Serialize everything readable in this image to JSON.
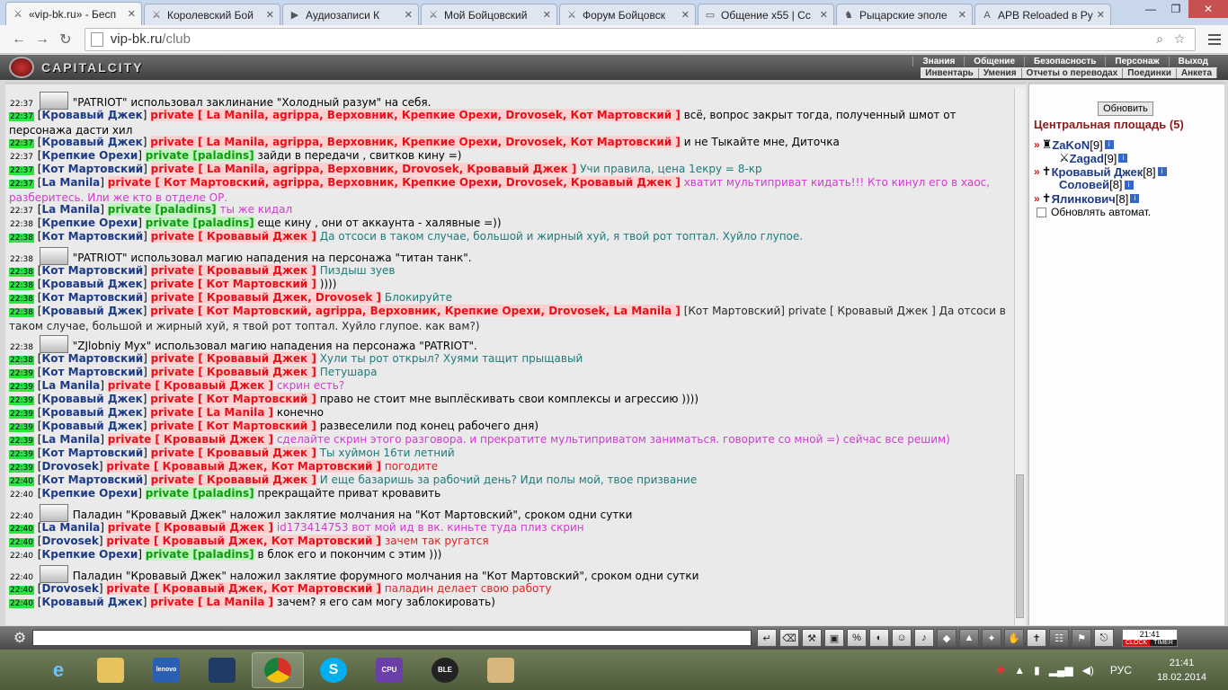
{
  "browser": {
    "tabs": [
      {
        "label": "«vip-bk.ru» - Бесп",
        "icon": "swords-icon",
        "active": true
      },
      {
        "label": "Королевский Бой",
        "icon": "swords-icon"
      },
      {
        "label": "Аудиозаписи К",
        "icon": "audio-icon"
      },
      {
        "label": "Мой Бойцовский",
        "icon": "swords-icon"
      },
      {
        "label": "Форум Бойцовск",
        "icon": "swords-icon"
      },
      {
        "label": "Общение х55 | Сс",
        "icon": "page-icon"
      },
      {
        "label": "Рыцарские эполе",
        "icon": "knight-icon"
      },
      {
        "label": "APB Reloaded в Ру",
        "icon": "apb-icon"
      }
    ],
    "url_host": "vip-bk.ru",
    "url_path": "/club"
  },
  "site": {
    "logo_text": "CAPITALCITY",
    "top_nav": [
      "Знания",
      "Общение",
      "Безопасность",
      "Персонаж",
      "Выход"
    ],
    "sub_nav": [
      "Инвентарь",
      "Умения",
      "Отчеты о переводах",
      "Поединки",
      "Анкета"
    ]
  },
  "chat": {
    "messages": [
      {
        "time": "22:37",
        "hl": false,
        "sys": true,
        "text": "\"PATRIOT\" использовал заклинание \"Холодный разум\" на себя."
      },
      {
        "time": "22:37",
        "hl": true,
        "nick": "Кровавый Джек",
        "priv": "private [ La Manila, agrippa, Верховник, Крепкие Орехи, Drovosek, Кот Мартовский ]",
        "privType": "pm",
        "text": "всё, вопрос закрыт тогда, полученный шмот от персонажа дасти хил",
        "tc": "t-black",
        "lines": 2
      },
      {
        "time": "22:37",
        "hl": true,
        "nick": "Кровавый Джек",
        "priv": "private [ La Manila, agrippa, Верховник, Крепкие Орехи, Drovosek, Кот Мартовский ]",
        "privType": "pm",
        "text": "и не Тыкайте мне, Диточка",
        "tc": "t-black"
      },
      {
        "time": "22:37",
        "hl": false,
        "nick": "Крепкие Орехи",
        "priv": "private [paladins]",
        "privType": "pal",
        "text": "зайди в передачи , свитков кину =)",
        "tc": "t-black"
      },
      {
        "time": "22:37",
        "hl": true,
        "nick": "Кот Мартовский",
        "priv": "private [ La Manila, agrippa, Верховник, Drovosek, Кровавый Джек ]",
        "privType": "pm",
        "text": "Учи правила, цена 1екру = 8-кр",
        "tc": "t-teal"
      },
      {
        "time": "22:37",
        "hl": true,
        "nick": "La Manila",
        "priv": "private [ Кот Мартовский, agrippa, Верховник, Крепкие Орехи, Drovosek, Кровавый Джек ]",
        "privType": "pm",
        "text": "хватит мультиприват кидать!!! Кто кинул его в хаос, разберитесь. Или же кто в отделе ОР.",
        "tc": "t-mag",
        "lines": 2
      },
      {
        "time": "22:37",
        "hl": false,
        "nick": "La Manila",
        "priv": "private [paladins]",
        "privType": "pal",
        "text": "ты же кидал",
        "tc": "t-mag"
      },
      {
        "time": "22:38",
        "hl": false,
        "nick": "Крепкие Орехи",
        "priv": "private [paladins]",
        "privType": "pal",
        "text": "еще кину , они от аккаунта - халявные =))",
        "tc": "t-black"
      },
      {
        "time": "22:38",
        "hl": true,
        "nick": "Кот Мартовский",
        "priv": "private [ Кровавый Джек ]",
        "privType": "pm",
        "text": "Да отсоси в таком случае, большой и жирный хуй, я твой рот топтал. Хуйло глупое.",
        "tc": "t-teal"
      },
      {
        "time": "22:38",
        "hl": false,
        "sys": true,
        "text": "\"PATRIOT\" использовал магию нападения на персонажа \"титан танк\"."
      },
      {
        "time": "22:38",
        "hl": true,
        "nick": "Кот Мартовский",
        "priv": "private [ Кровавый Джек ]",
        "privType": "pm",
        "text": "Пиздыш зуев",
        "tc": "t-teal"
      },
      {
        "time": "22:38",
        "hl": true,
        "nick": "Кровавый Джек",
        "priv": "private [ Кот Мартовский ]",
        "privType": "pm",
        "text": "))))",
        "tc": "t-black"
      },
      {
        "time": "22:38",
        "hl": true,
        "nick": "Кот Мартовский",
        "priv": "private [ Кровавый Джек, Drovosek ]",
        "privType": "pm",
        "text": "Блокируйте",
        "tc": "t-teal"
      },
      {
        "time": "22:38",
        "hl": true,
        "nick": "Кровавый Джек",
        "priv": "private [ Кот Мартовский, agrippa, Верховник, Крепкие Орехи, Drovosek, La Manila ]",
        "privType": "pm",
        "text": "[Кот Мартовский] private [ Кровавый Джек ] Да отсоси в таком случае, большой и жирный хуй, я твой рот топтал. Хуйло глупое. как вам?)",
        "tc": "t-dark",
        "lines": 2
      },
      {
        "time": "22:38",
        "hl": false,
        "sys": true,
        "text": "\"ZJlobniy Myx\" использовал магию нападения на персонажа \"PATRIOT\"."
      },
      {
        "time": "22:38",
        "hl": true,
        "nick": "Кот Мартовский",
        "priv": "private [ Кровавый Джек ]",
        "privType": "pm",
        "text": "Хули ты рот открыл? Хуями тащит прыщавый",
        "tc": "t-teal"
      },
      {
        "time": "22:39",
        "hl": true,
        "nick": "Кот Мартовский",
        "priv": "private [ Кровавый Джек ]",
        "privType": "pm",
        "text": "Петушара",
        "tc": "t-teal"
      },
      {
        "time": "22:39",
        "hl": true,
        "nick": "La Manila",
        "priv": "private [ Кровавый Джек ]",
        "privType": "pm",
        "text": "скрин есть?",
        "tc": "t-mag"
      },
      {
        "time": "22:39",
        "hl": true,
        "nick": "Кровавый Джек",
        "priv": "private [ Кот Мартовский ]",
        "privType": "pm",
        "text": "право не стоит мне выплёскивать свои комплексы и агрессию ))))",
        "tc": "t-black"
      },
      {
        "time": "22:39",
        "hl": true,
        "nick": "Кровавый Джек",
        "priv": "private [ La Manila ]",
        "privType": "pm",
        "text": "конечно",
        "tc": "t-black"
      },
      {
        "time": "22:39",
        "hl": true,
        "nick": "Кровавый Джек",
        "priv": "private [ Кот Мартовский ]",
        "privType": "pm",
        "text": "развеселили под конец рабочего дня)",
        "tc": "t-black"
      },
      {
        "time": "22:39",
        "hl": true,
        "nick": "La Manila",
        "priv": "private [ Кровавый Джек ]",
        "privType": "pm",
        "text": "сделайте скрин этого разговора. и прекратите мультиприватом заниматься. говорите со мной =) сейчас все решим)",
        "tc": "t-mag"
      },
      {
        "time": "22:39",
        "hl": true,
        "nick": "Кот Мартовский",
        "priv": "private [ Кровавый Джек ]",
        "privType": "pm",
        "text": "Ты хуймон 16ти летний",
        "tc": "t-teal"
      },
      {
        "time": "22:39",
        "hl": true,
        "nick": "Drovosek",
        "priv": "private [ Кровавый Джек, Кот Мартовский ]",
        "privType": "pm",
        "text": "погодите",
        "tc": "t-red"
      },
      {
        "time": "22:40",
        "hl": true,
        "nick": "Кот Мартовский",
        "priv": "private [ Кровавый Джек ]",
        "privType": "pm",
        "text": "И еще базаришь за рабочий день? Иди полы мой, твое призвание",
        "tc": "t-teal"
      },
      {
        "time": "22:40",
        "hl": false,
        "nick": "Крепкие Орехи",
        "priv": "private [paladins]",
        "privType": "pal",
        "text": "прекращайте приват кровавить",
        "tc": "t-black"
      },
      {
        "time": "22:40",
        "hl": false,
        "sys": true,
        "text": "Паладин \"Кровавый Джек\" наложил заклятие молчания на \"Кот Мартовский\", сроком одни сутки"
      },
      {
        "time": "22:40",
        "hl": true,
        "nick": "La Manila",
        "priv": "private [ Кровавый Джек ]",
        "privType": "pm",
        "text": "id173414753 вот мой ид в вк. киньте туда плиз скрин",
        "tc": "t-mag"
      },
      {
        "time": "22:40",
        "hl": true,
        "nick": "Drovosek",
        "priv": "private [ Кровавый Джек, Кот Мартовский ]",
        "privType": "pm",
        "text": "зачем так ругатся",
        "tc": "t-red"
      },
      {
        "time": "22:40",
        "hl": false,
        "nick": "Крепкие Орехи",
        "priv": "private [paladins]",
        "privType": "pal",
        "text": "в блок его и покончим с этим )))",
        "tc": "t-black"
      },
      {
        "time": "22:40",
        "hl": false,
        "sys": true,
        "text": "Паладин \"Кровавый Джек\" наложил заклятие форумного молчания на \"Кот Мартовский\", сроком одни сутки"
      },
      {
        "time": "22:40",
        "hl": true,
        "nick": "Drovosek",
        "priv": "private [ Кровавый Джек, Кот Мартовский ]",
        "privType": "pm",
        "text": "паладин делает свою работу",
        "tc": "t-red"
      },
      {
        "time": "22:40",
        "hl": true,
        "nick": "Кровавый Джек",
        "priv": "private [ La Manila ]",
        "privType": "pm",
        "text": "зачем? я его сам могу заблокировать)",
        "tc": "t-black"
      }
    ]
  },
  "room": {
    "refresh_label": "Обновить",
    "title": "Центральная площадь (5)",
    "players": [
      {
        "name": "ZaKoN",
        "level": "[9]",
        "prefix": "»",
        "icons": "warrior-icon"
      },
      {
        "name": "Zagad",
        "level": "[9]",
        "prefix": "",
        "icons": "paladin-icon"
      },
      {
        "name": "Кровавый Джек",
        "level": "[8]",
        "prefix": "»",
        "icons": "cross-icon"
      },
      {
        "name": "Соловей",
        "level": "[8]",
        "prefix": "",
        "icons": ""
      },
      {
        "name": "Ялинкович",
        "level": "[8]",
        "prefix": "»",
        "icons": "cross-icon"
      }
    ],
    "auto_refresh_label": "Обновлять автомат."
  },
  "toolbar": {
    "clock_text": "21:41",
    "clock_label": "CLOCK",
    "timer_label": "TIMER"
  },
  "taskbar": {
    "lang": "РУС",
    "time": "21:41",
    "date": "18.02.2014"
  }
}
